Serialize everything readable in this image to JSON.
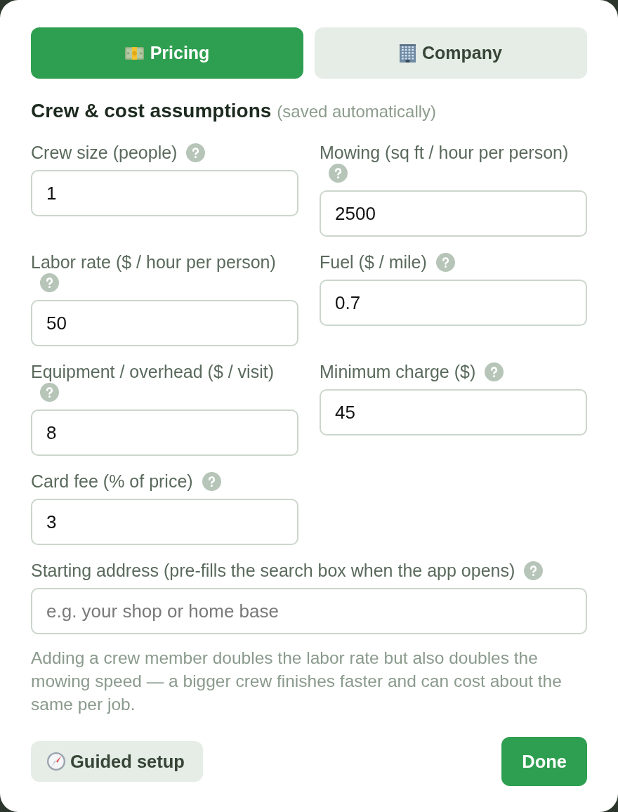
{
  "tabs": [
    {
      "label": "Pricing",
      "selected": true
    },
    {
      "label": "Company",
      "selected": false
    }
  ],
  "section": {
    "title": "Crew & cost assumptions",
    "note": "(saved automatically)"
  },
  "fields": [
    {
      "label": "Crew size (people)",
      "value": "1"
    },
    {
      "label": "Mowing (sq ft / hour per person)",
      "value": "2500"
    },
    {
      "label": "Labor rate ($ / hour per person)",
      "value": "50"
    },
    {
      "label": "Fuel ($ / mile)",
      "value": "0.7"
    },
    {
      "label": "Equipment / overhead ($ / visit)",
      "value": "8"
    },
    {
      "label": "Minimum charge ($)",
      "value": "45"
    },
    {
      "label": "Card fee (% of price)",
      "value": "3"
    }
  ],
  "address_field": {
    "label": "Starting address (pre-fills the search box when the app opens)",
    "placeholder": "e.g. your shop or home base"
  },
  "help_text": "Adding a crew member doubles the labor rate but also doubles the mowing speed — a bigger crew finishes faster and can cost about the same per job.",
  "buttons": [
    {
      "kind": "secondary",
      "label": "Guided setup"
    },
    {
      "kind": "primary",
      "label": "Done"
    }
  ]
}
